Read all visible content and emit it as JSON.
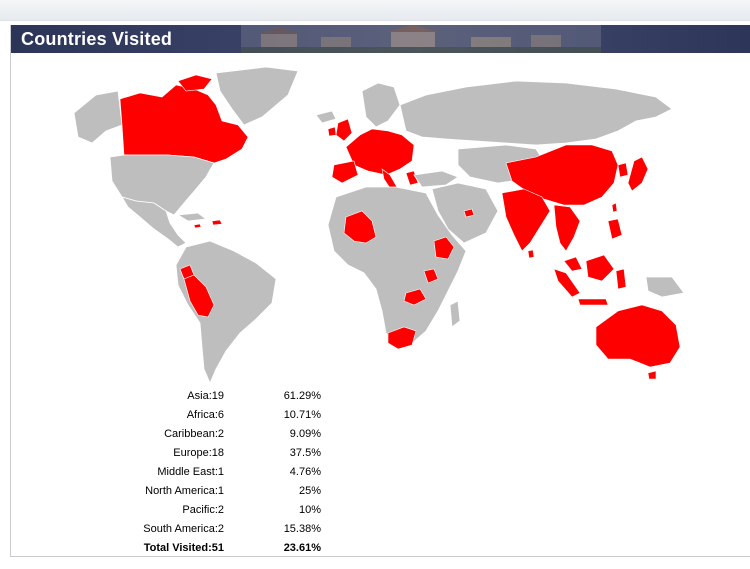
{
  "header": {
    "title": "Countries Visited"
  },
  "map": {
    "visited_color": "#ff0000",
    "unvisited_color": "#bebebe",
    "visited_countries": [
      "Canada",
      "Peru",
      "Ecuador",
      "Dominican Republic",
      "Jamaica",
      "United Kingdom",
      "Ireland",
      "France",
      "Spain",
      "Portugal",
      "Germany",
      "Italy",
      "Austria",
      "Czech Republic",
      "Hungary",
      "Croatia",
      "Greece",
      "Netherlands",
      "Belgium",
      "Switzerland",
      "Poland",
      "Denmark",
      "Mali",
      "Burkina Faso",
      "Ethiopia",
      "Tanzania",
      "Zambia",
      "South Africa",
      "United Arab Emirates",
      "China",
      "India",
      "Nepal",
      "Japan",
      "South Korea",
      "Thailand",
      "Vietnam",
      "Cambodia",
      "Laos",
      "Myanmar",
      "Malaysia",
      "Singapore",
      "Indonesia",
      "Philippines",
      "Taiwan",
      "Sri Lanka",
      "Bhutan",
      "Mongolia",
      "Hong Kong",
      "Australia",
      "New Zealand"
    ]
  },
  "stats": {
    "rows": [
      {
        "label": "Asia:19",
        "value": "61.29%"
      },
      {
        "label": "Africa:6",
        "value": "10.71%"
      },
      {
        "label": "Caribbean:2",
        "value": "9.09%"
      },
      {
        "label": "Europe:18",
        "value": "37.5%"
      },
      {
        "label": "Middle East:1",
        "value": "4.76%"
      },
      {
        "label": "North America:1",
        "value": "25%"
      },
      {
        "label": "Pacific:2",
        "value": "10%"
      },
      {
        "label": "South America:2",
        "value": "15.38%"
      }
    ],
    "total": {
      "label": "Total Visited:51",
      "value": "23.61%"
    }
  }
}
